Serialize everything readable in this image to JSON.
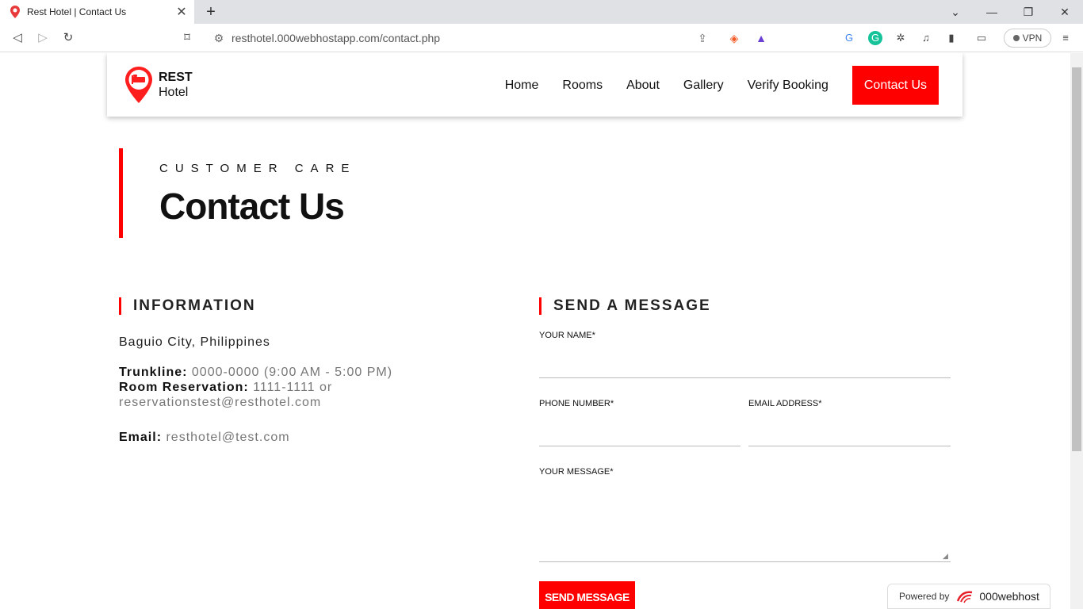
{
  "browser": {
    "tab_title": "Rest Hotel | Contact Us",
    "tab_close": "✕",
    "new_tab": "+",
    "url": "resthotel.000webhostapp.com/contact.php",
    "vpn_label": "VPN",
    "win_minimize": "—",
    "win_restore": "❐",
    "win_close": "✕",
    "tab_list": "⌄"
  },
  "site": {
    "logo_line1": "REST",
    "logo_line2": "Hotel",
    "nav": [
      "Home",
      "Rooms",
      "About",
      "Gallery",
      "Verify Booking",
      "Contact Us"
    ],
    "accent_color": "#ff0000"
  },
  "hero": {
    "eyebrow": "CUSTOMER CARE",
    "title": "Contact Us"
  },
  "information": {
    "heading": "INFORMATION",
    "location": "Baguio City, Philippines",
    "trunkline_label": "Trunkline:",
    "trunkline_value": "0000-0000 (9:00 AM - 5:00 PM)",
    "reservation_label": "Room Reservation:",
    "reservation_value": "1111-1111 or",
    "reservation_email": "reservationstest@resthotel.com",
    "email_label": "Email:",
    "email_value": "resthotel@test.com"
  },
  "form": {
    "heading": "SEND A MESSAGE",
    "name_label": "YOUR NAME*",
    "phone_label": "PHONE NUMBER*",
    "email_label": "EMAIL ADDRESS*",
    "message_label": "YOUR MESSAGE*",
    "submit_label": "SEND MESSAGE"
  },
  "footer_badge": {
    "prefix": "Powered by",
    "brand": "000webhost"
  }
}
